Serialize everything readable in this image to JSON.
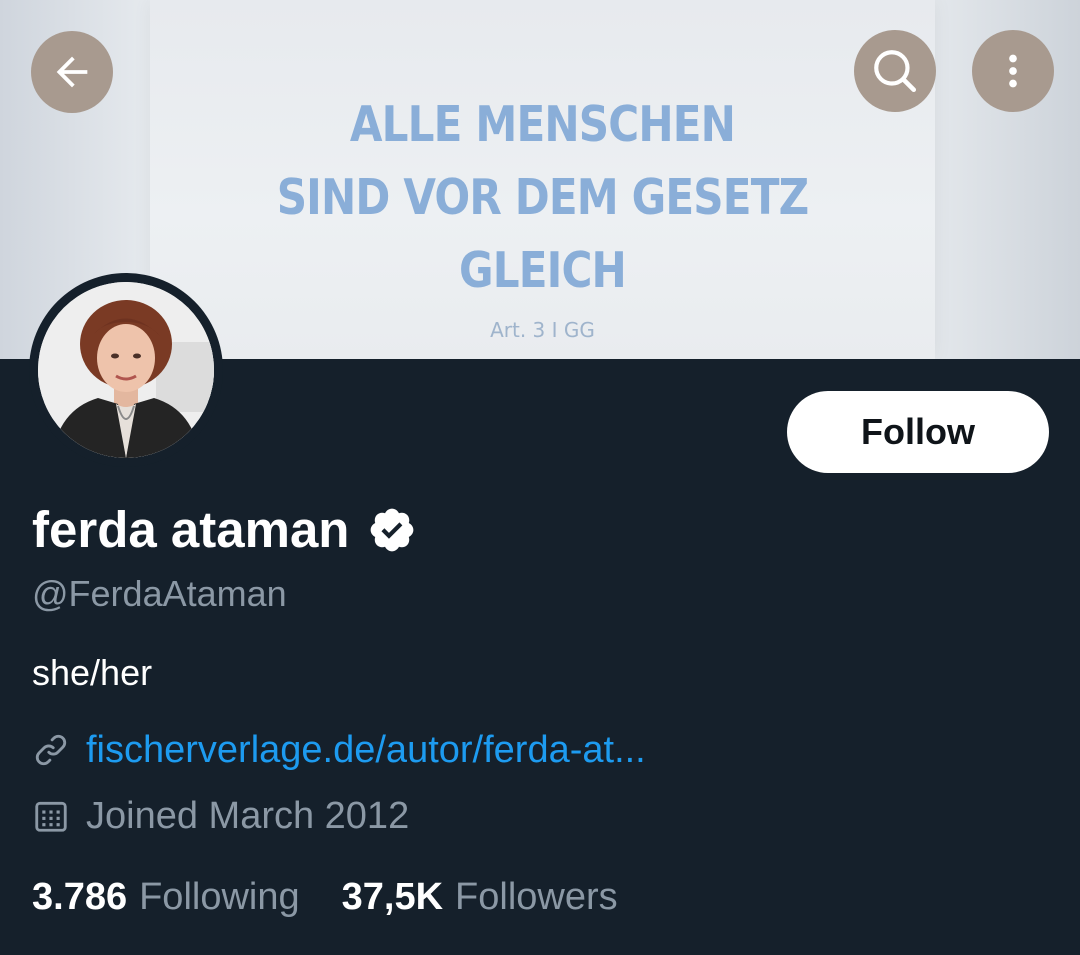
{
  "banner": {
    "slogan": "ALLE MENSCHEN\nSIND VOR DEM GESETZ\nGLEICH",
    "reference": "Art. 3 I GG"
  },
  "header": {
    "back_icon": "arrow-left-icon",
    "search_icon": "search-icon",
    "more_icon": "more-vertical-icon"
  },
  "profile": {
    "display_name": "ferda ataman",
    "verified_icon": "verified-badge-icon",
    "handle": "@FerdaAtaman",
    "bio": "she/her",
    "link_icon": "link-icon",
    "link": "fischerverlage.de/autor/ferda-at...",
    "calendar_icon": "calendar-icon",
    "joined": "Joined March 2012",
    "follow_label": "Follow"
  },
  "stats": {
    "following_count": "3.786",
    "following_label": "Following",
    "followers_count": "37,5K",
    "followers_label": "Followers"
  },
  "colors": {
    "background": "#15202b",
    "link": "#1d9bf0",
    "secondary_text": "#8b98a5",
    "banner_text": "#8aaed8"
  }
}
